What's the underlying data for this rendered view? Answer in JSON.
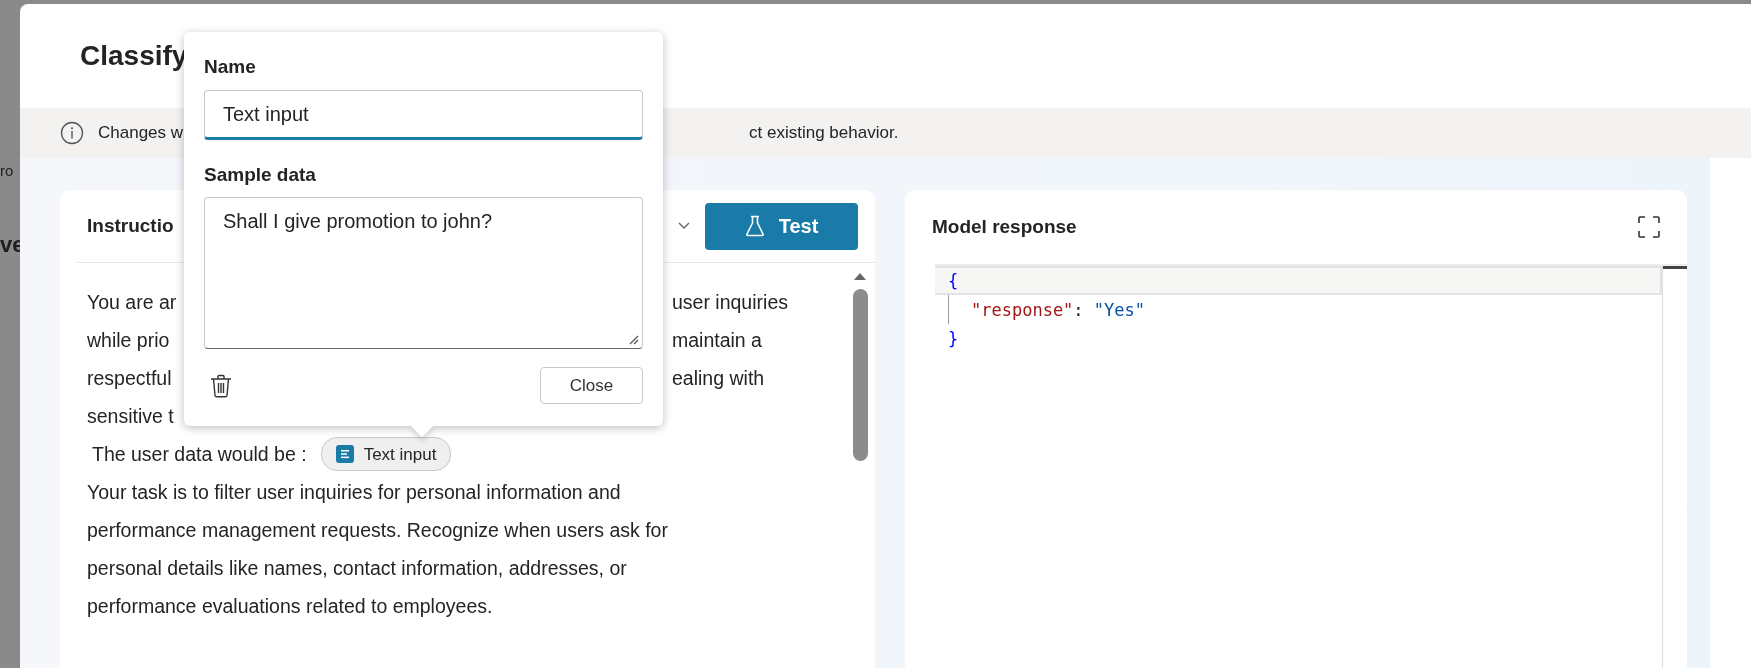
{
  "background_page": {
    "fragments": [
      {
        "text": "ro"
      },
      {
        "text": "ve"
      }
    ]
  },
  "dialog": {
    "title": "Classify",
    "notice": {
      "before": "Changes w",
      "after": "ct existing behavior."
    }
  },
  "instructions": {
    "title": "Instructio",
    "lines": [
      {
        "left": "You are ar",
        "right": "user inquiries"
      },
      {
        "left": "while prio",
        "right": "maintain a"
      },
      {
        "left": "respectful",
        "right": "ealing with"
      },
      {
        "left": "sensitive t"
      }
    ],
    "variable_line": {
      "label": "The user data would be :",
      "chip": "Text input"
    },
    "paragraph": "Your task is to filter user inquiries for personal information and performance management requests. Recognize when users ask for personal details like names, contact information, addresses, or performance evaluations related to employees."
  },
  "test_button": "Test",
  "model_response": {
    "title": "Model response",
    "code": [
      {
        "indented": false,
        "current": true,
        "tokens": [
          {
            "kind": "brace",
            "text": "{"
          }
        ]
      },
      {
        "indented": true,
        "current": false,
        "tokens": [
          {
            "kind": "key",
            "text": "\"response\""
          },
          {
            "kind": "punct",
            "text": ": "
          },
          {
            "kind": "string",
            "text": "\"Yes\""
          }
        ]
      },
      {
        "indented": false,
        "current": false,
        "tokens": [
          {
            "kind": "brace",
            "text": "}"
          }
        ]
      }
    ]
  },
  "popup": {
    "name_label": "Name",
    "name_value": "Text input",
    "sample_label": "Sample data",
    "sample_value": "Shall I give promotion to john?",
    "close_button": "Close"
  }
}
